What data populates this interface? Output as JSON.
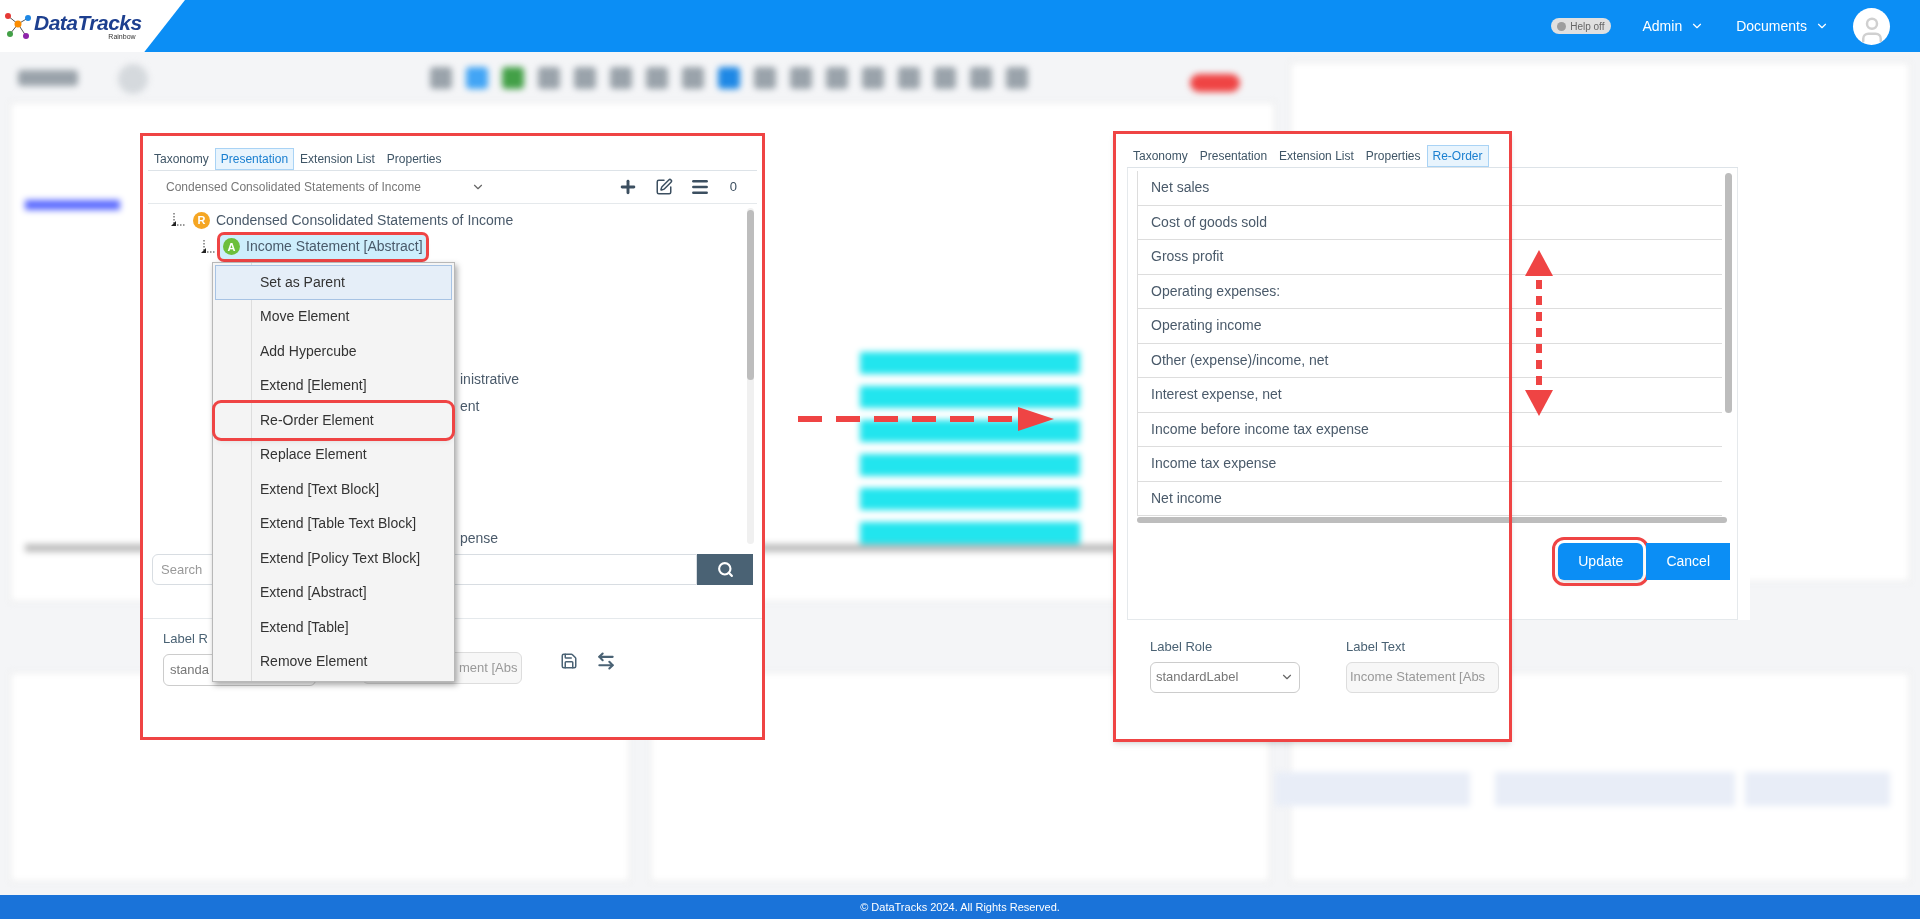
{
  "header": {
    "logo": {
      "name": "DataTracks",
      "tagline": "Rainbow"
    },
    "help_toggle": {
      "label": "Help off",
      "on": false
    },
    "menus": [
      "Admin",
      "Documents"
    ]
  },
  "left_panel": {
    "tabs": [
      {
        "label": "Taxonomy",
        "selected": false
      },
      {
        "label": "Presentation",
        "selected": true
      },
      {
        "label": "Extension List",
        "selected": false
      },
      {
        "label": "Properties",
        "selected": false
      }
    ],
    "statement_dropdown": "Condensed Consolidated Statements of Income",
    "count": "0",
    "tree": [
      {
        "label": "Condensed Consolidated Statements of Income",
        "badge": "R",
        "kind": "role",
        "selected": false,
        "annotated": false,
        "children": [
          {
            "label": "Income Statement [Abstract]",
            "badge": "A",
            "kind": "abstract",
            "selected": true,
            "annotated": true
          }
        ]
      }
    ],
    "covered_rows": [
      "inistrative",
      "ent",
      "pense"
    ],
    "search": {
      "placeholder": "Search"
    },
    "label_role": {
      "label": "Label R",
      "value": "standa"
    },
    "label_text": {
      "value": "ment [Abs"
    }
  },
  "context_menu": {
    "items": [
      {
        "label": "Set as Parent",
        "selected": true,
        "annotated": false
      },
      {
        "label": "Move Element",
        "selected": false,
        "annotated": false
      },
      {
        "label": "Add Hypercube",
        "selected": false,
        "annotated": false
      },
      {
        "label": "Extend [Element]",
        "selected": false,
        "annotated": false
      },
      {
        "label": "Re-Order Element",
        "selected": false,
        "annotated": true
      },
      {
        "label": "Replace Element",
        "selected": false,
        "annotated": false
      },
      {
        "label": "Extend [Text Block]",
        "selected": false,
        "annotated": false
      },
      {
        "label": "Extend [Table Text Block]",
        "selected": false,
        "annotated": false
      },
      {
        "label": "Extend [Policy Text Block]",
        "selected": false,
        "annotated": false
      },
      {
        "label": "Extend [Abstract]",
        "selected": false,
        "annotated": false
      },
      {
        "label": "Extend [Table]",
        "selected": false,
        "annotated": false
      },
      {
        "label": "Remove Element",
        "selected": false,
        "annotated": false
      }
    ]
  },
  "right_panel": {
    "tabs": [
      {
        "label": "Taxonomy",
        "selected": false
      },
      {
        "label": "Presentation",
        "selected": false
      },
      {
        "label": "Extension List",
        "selected": false
      },
      {
        "label": "Properties",
        "selected": false
      },
      {
        "label": "Re-Order",
        "selected": true
      }
    ],
    "reorder_items": [
      "Net sales",
      "Cost of goods sold",
      "Gross profit",
      "Operating expenses:",
      "Operating income",
      "Other (expense)/income, net",
      "Interest expense, net",
      "Income before income tax expense",
      "Income tax expense",
      "Net income"
    ],
    "buttons": [
      {
        "label": "Update",
        "annotated": true
      },
      {
        "label": "Cancel",
        "annotated": false
      }
    ],
    "label_role": {
      "label": "Label Role",
      "value": "standardLabel"
    },
    "label_text": {
      "label": "Label Text",
      "value": "Income Statement [Abs"
    }
  },
  "footer": "© DataTracks 2024. All Rights Reserved."
}
